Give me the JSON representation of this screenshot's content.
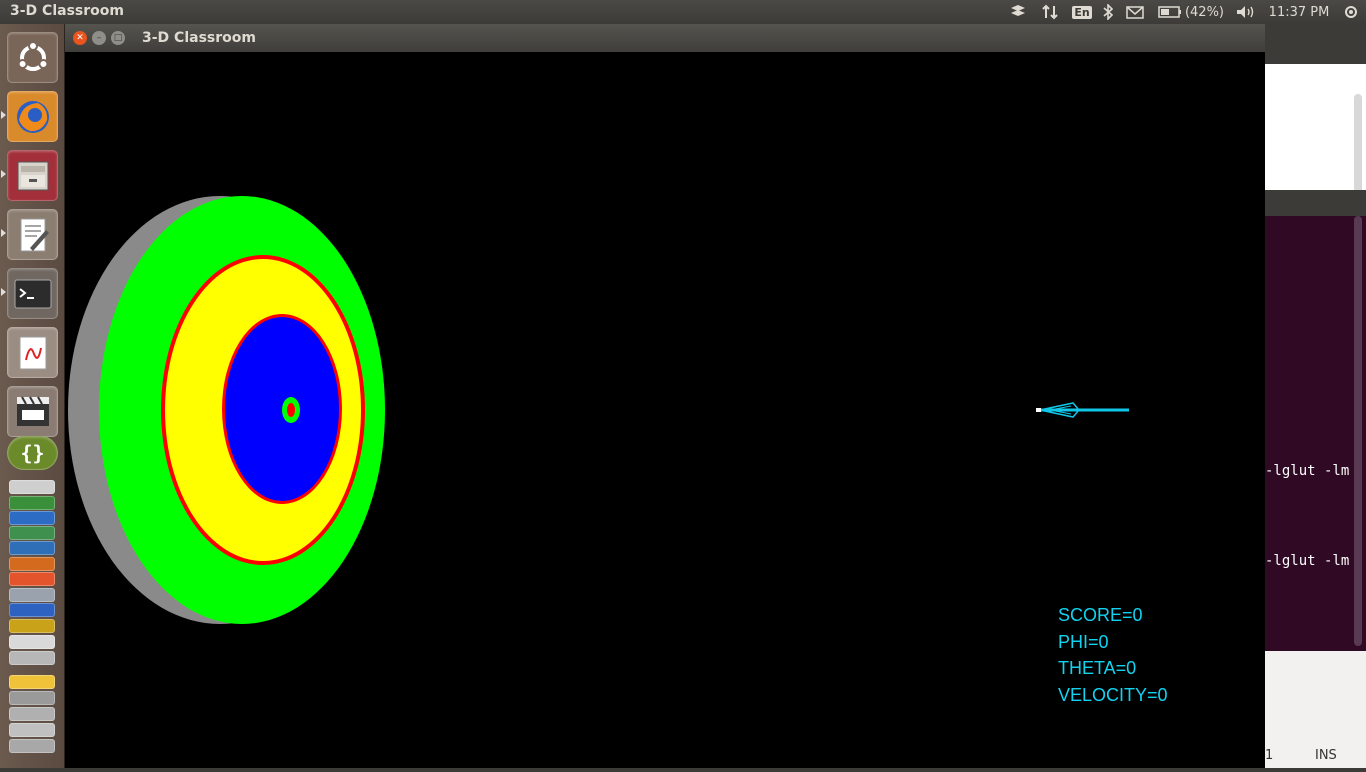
{
  "top_panel": {
    "app_title": "3-D Classroom",
    "keyboard_layout": "En",
    "battery": "(42%)",
    "time": "11:37 PM"
  },
  "window": {
    "title": "3-D Classroom"
  },
  "hud": {
    "score": "SCORE=0",
    "phi": "PHI=0",
    "theta": "THETA=0",
    "velocity": "VELOCITY=0"
  },
  "background_terminal": {
    "line1": "-lglut -lm",
    "line2": "-lglut -lm",
    "status_mode": "INS",
    "status_num": "1"
  },
  "target": {
    "colors": {
      "outer": "#00ff00",
      "ring_border": "#ff0000",
      "middle": "#ffff00",
      "inner": "#0000ff",
      "bullseye_ring": "#00ff00",
      "bullseye": "#ff0000",
      "edge": "#8a8a8a"
    }
  },
  "arrow": {
    "color": "#11c7e8"
  },
  "icons": [
    "ubuntu-logo-icon",
    "firefox-icon",
    "files-icon",
    "text-editor-icon",
    "terminal-icon",
    "document-viewer-icon",
    "video-editor-icon",
    "brackets-icon"
  ]
}
